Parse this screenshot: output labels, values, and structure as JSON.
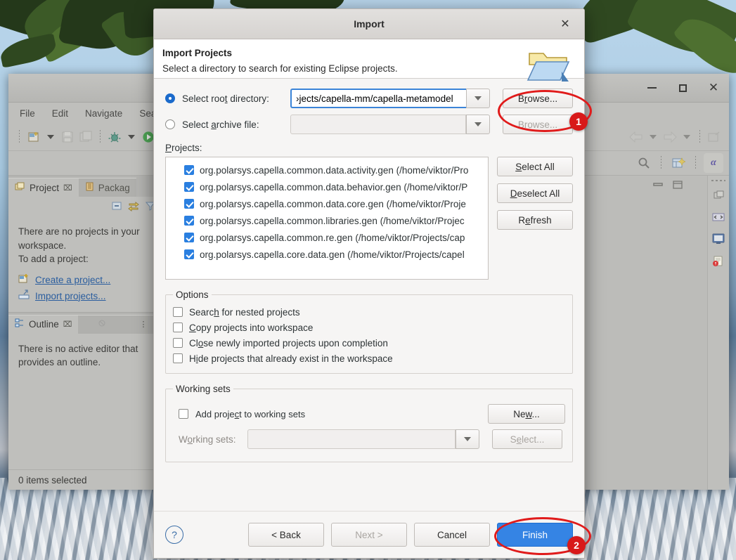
{
  "desktop": {
    "wallpaper_alt": "tree-leaves-over-sky-and-rocky-water"
  },
  "eclipse": {
    "window_controls": {
      "minimize": "–",
      "maximize": "⬜",
      "close": "✕"
    },
    "menu": [
      "File",
      "Edit",
      "Navigate",
      "Search"
    ],
    "toolbar_icons": [
      "new-file-icon",
      "save-icon",
      "save-all-icon",
      "debug-icon",
      "run-icon"
    ],
    "toolbar_right_icons": [
      "back-arrow-icon",
      "forward-arrow-icon",
      "open-type-icon",
      "search-icon",
      "new-perspective-icon",
      "capella-perspective-icon"
    ],
    "rail_icons": [
      "restore-icon",
      "code-icon",
      "console-icon",
      "problems-icon"
    ],
    "views": {
      "tabs": [
        {
          "label": "Project",
          "icon": "project-explorer-icon",
          "active": true,
          "close": "⌧"
        },
        {
          "label": "Packag",
          "icon": "package-explorer-icon",
          "active": false
        }
      ],
      "view_toolbar_icons": [
        "collapse-all-icon",
        "link-with-editor-icon",
        "filter-icon"
      ],
      "empty_text_line1": "There are no projects in your",
      "empty_text_line2": "workspace.",
      "empty_text_line3": "To add a project:",
      "links": [
        {
          "label": "Create a project...",
          "icon": "new-project-icon"
        },
        {
          "label": "Import projects...",
          "icon": "import-icon"
        }
      ]
    },
    "outline": {
      "tab_label": "Outline",
      "tab_close": "⌧",
      "toolbar_icons": [
        "no-outline-icon",
        "view-menu-icon"
      ],
      "empty_line1": "There is no active editor that",
      "empty_line2": "provides an outline."
    },
    "status_bar": "0 items selected"
  },
  "dialog": {
    "title": "Import",
    "close_glyph": "✕",
    "header": {
      "heading": "Import Projects",
      "subtitle": "Select a directory to search for existing Eclipse projects.",
      "icon": "import-folder-icon"
    },
    "source": {
      "root_directory": {
        "radio_label": "Select root directory:",
        "selected": true,
        "value": "›jects/capella-mm/capella-metamodel",
        "placeholder": "",
        "browse_label": "Browse...",
        "browse_enabled": true
      },
      "archive_file": {
        "radio_label": "Select archive file:",
        "selected": false,
        "value": "",
        "placeholder": "",
        "browse_label": "Browse...",
        "browse_enabled": false
      }
    },
    "projects": {
      "label": "Projects:",
      "items": [
        {
          "checked": true,
          "name": "org.polarsys.capella.common.data.activity.gen (/home/viktor/Pro"
        },
        {
          "checked": true,
          "name": "org.polarsys.capella.common.data.behavior.gen (/home/viktor/P"
        },
        {
          "checked": true,
          "name": "org.polarsys.capella.common.data.core.gen (/home/viktor/Proje"
        },
        {
          "checked": true,
          "name": "org.polarsys.capella.common.libraries.gen (/home/viktor/Projec"
        },
        {
          "checked": true,
          "name": "org.polarsys.capella.common.re.gen (/home/viktor/Projects/cap"
        },
        {
          "checked": true,
          "name": "org.polarsys.capella.core.data.gen (/home/viktor/Projects/capel"
        }
      ],
      "buttons": [
        {
          "label": "Select All",
          "enabled": true
        },
        {
          "label": "Deselect All",
          "enabled": true
        },
        {
          "label": "Refresh",
          "enabled": true
        }
      ]
    },
    "options": {
      "legend": "Options",
      "items": [
        {
          "label": "Search for nested projects",
          "checked": false
        },
        {
          "label": "Copy projects into workspace",
          "checked": false
        },
        {
          "label": "Close newly imported projects upon completion",
          "checked": false
        },
        {
          "label": "Hide projects that already exist in the workspace",
          "checked": false
        }
      ]
    },
    "working_sets": {
      "legend": "Working sets",
      "add_checkbox_label": "Add project to working sets",
      "add_checked": false,
      "new_button": "New...",
      "combo_label": "Working sets:",
      "combo_value": "",
      "select_button": "Select...",
      "enabled": false
    },
    "footer": {
      "help_icon": "help-icon",
      "help_glyph": "?",
      "back": {
        "label": "< Back",
        "enabled": true
      },
      "next": {
        "label": "Next >",
        "enabled": false
      },
      "cancel": {
        "label": "Cancel",
        "enabled": true
      },
      "finish": {
        "label": "Finish",
        "enabled": true,
        "primary": true
      }
    }
  },
  "annotations": {
    "accent_color": "#d81919",
    "markers": [
      {
        "number": "1",
        "target": "browse-root-directory-button"
      },
      {
        "number": "2",
        "target": "finish-button"
      }
    ]
  }
}
